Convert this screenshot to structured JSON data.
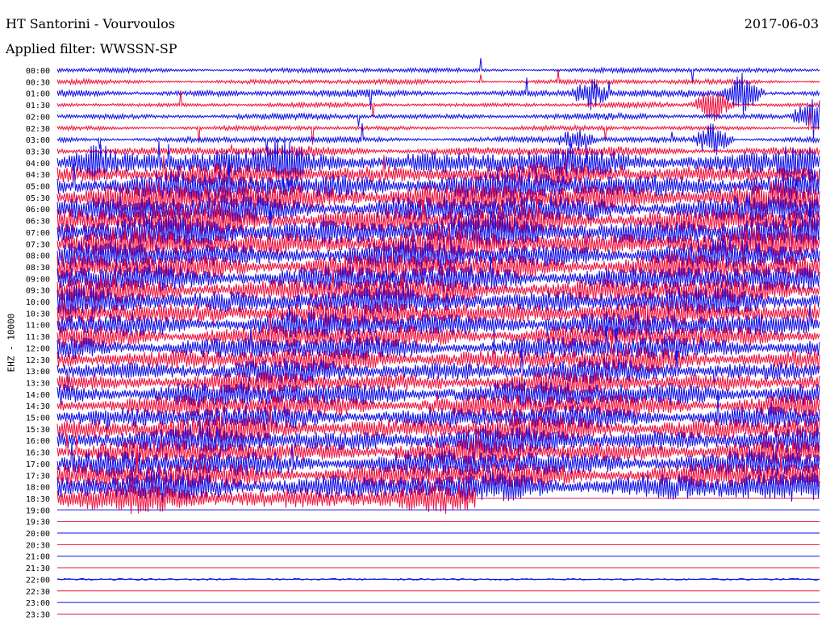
{
  "header": {
    "title": "HT Santorini - Vourvoulos",
    "date": "2017-06-03",
    "filter": "Applied filter: WWSSN-SP"
  },
  "colors": {
    "trace_a": "#1010e8",
    "trace_b": "#f0103a"
  },
  "chart_data": {
    "type": "line",
    "title": "HT Santorini - Vourvoulos",
    "subtitle": "Applied filter: WWSSN-SP",
    "ylabel": "EHZ - 10000",
    "xlabel": "",
    "y_ticks": [
      "00:00",
      "00:30",
      "01:00",
      "01:30",
      "02:00",
      "02:30",
      "03:00",
      "03:30",
      "04:00",
      "04:30",
      "05:00",
      "05:30",
      "06:00",
      "06:30",
      "07:00",
      "07:30",
      "08:00",
      "08:30",
      "09:00",
      "09:30",
      "10:00",
      "10:30",
      "11:00",
      "11:30",
      "12:00",
      "12:30",
      "13:00",
      "13:30",
      "14:00",
      "14:30",
      "15:00",
      "15:30",
      "16:00",
      "16:30",
      "17:00",
      "17:30",
      "18:00",
      "18:30",
      "19:00",
      "19:30",
      "20:00",
      "20:30",
      "21:00",
      "21:30",
      "22:00",
      "22:30",
      "23:00",
      "23:30"
    ],
    "row_amplitude": [
      0.4,
      0.4,
      0.6,
      0.4,
      0.5,
      0.4,
      0.5,
      0.8,
      2.2,
      1.8,
      2.4,
      2.6,
      2.4,
      2.5,
      2.6,
      2.4,
      2.3,
      2.3,
      2.3,
      2.2,
      2.3,
      2.2,
      2.2,
      2.0,
      2.0,
      2.0,
      1.9,
      1.8,
      2.2,
      2.0,
      2.0,
      2.1,
      2.2,
      2.0,
      2.2,
      2.2,
      2.4,
      2.2,
      0,
      0,
      0,
      0,
      0,
      0,
      0.15,
      0,
      0,
      0
    ],
    "data_end_fraction": [
      1,
      1,
      1,
      1,
      1,
      1,
      1,
      1,
      1,
      1,
      1,
      1,
      1,
      1,
      1,
      1,
      1,
      1,
      1,
      1,
      1,
      1,
      1,
      1,
      1,
      1,
      1,
      1,
      1,
      1,
      1,
      1,
      1,
      1,
      1,
      1,
      1,
      0.55,
      0,
      0,
      0,
      0,
      0,
      0,
      0,
      0,
      0,
      0
    ],
    "events": [
      {
        "row": 2,
        "pos": 0.7,
        "size": 2.5
      },
      {
        "row": 2,
        "pos": 0.9,
        "size": 3.5
      },
      {
        "row": 3,
        "pos": 0.86,
        "size": 3.0
      },
      {
        "row": 4,
        "pos": 0.99,
        "size": 4.0
      },
      {
        "row": 6,
        "pos": 0.86,
        "size": 3.0
      },
      {
        "row": 6,
        "pos": 0.68,
        "size": 1.8
      },
      {
        "row": 8,
        "pos": 0.05,
        "size": 2.2
      },
      {
        "row": 8,
        "pos": 0.3,
        "size": 2.5
      },
      {
        "row": 8,
        "pos": 0.97,
        "size": 2.5
      }
    ]
  }
}
